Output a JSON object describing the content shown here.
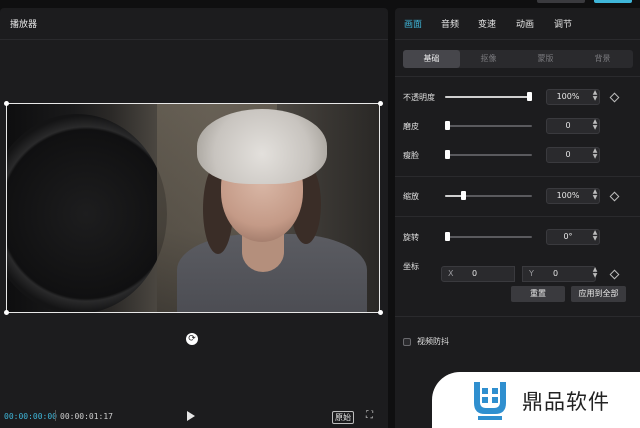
{
  "player": {
    "title": "播放器",
    "time_current": "00:00:00:00",
    "time_total": "00:00:01:17",
    "ratio_label": "原始"
  },
  "props": {
    "tabs": [
      {
        "label": "画面",
        "active": true
      },
      {
        "label": "音频",
        "active": false
      },
      {
        "label": "变速",
        "active": false
      },
      {
        "label": "动画",
        "active": false
      },
      {
        "label": "调节",
        "active": false
      }
    ],
    "subtabs": [
      {
        "label": "基础",
        "active": true
      },
      {
        "label": "抠像",
        "active": false
      },
      {
        "label": "蒙版",
        "active": false
      },
      {
        "label": "背景",
        "active": false
      }
    ],
    "opacity": {
      "label": "不透明度",
      "value": "100%",
      "level": 1.0
    },
    "smooth": {
      "label": "磨皮",
      "value": "0",
      "level": 0.0
    },
    "slim": {
      "label": "瘦脸",
      "value": "0",
      "level": 0.0
    },
    "scale": {
      "label": "缩放",
      "value": "100%",
      "level": 0.2
    },
    "rotate": {
      "label": "旋转",
      "value": "0°",
      "level": 0.0
    },
    "position": {
      "label": "坐标",
      "x_axis": "X",
      "x_value": "0",
      "y_axis": "Y",
      "y_value": "0"
    },
    "reset_label": "重置",
    "apply_all_label": "应用到全部",
    "stabilize_label": "视频防抖"
  },
  "watermark": {
    "text": "鼎品软件"
  },
  "colors": {
    "accent": "#3fb6d9",
    "panel": "#1c1c1e",
    "background": "#0f0f10"
  },
  "icons": [
    "rotate-icon",
    "play-icon",
    "fullscreen-icon",
    "keyframe-icon",
    "stepper-icon"
  ]
}
